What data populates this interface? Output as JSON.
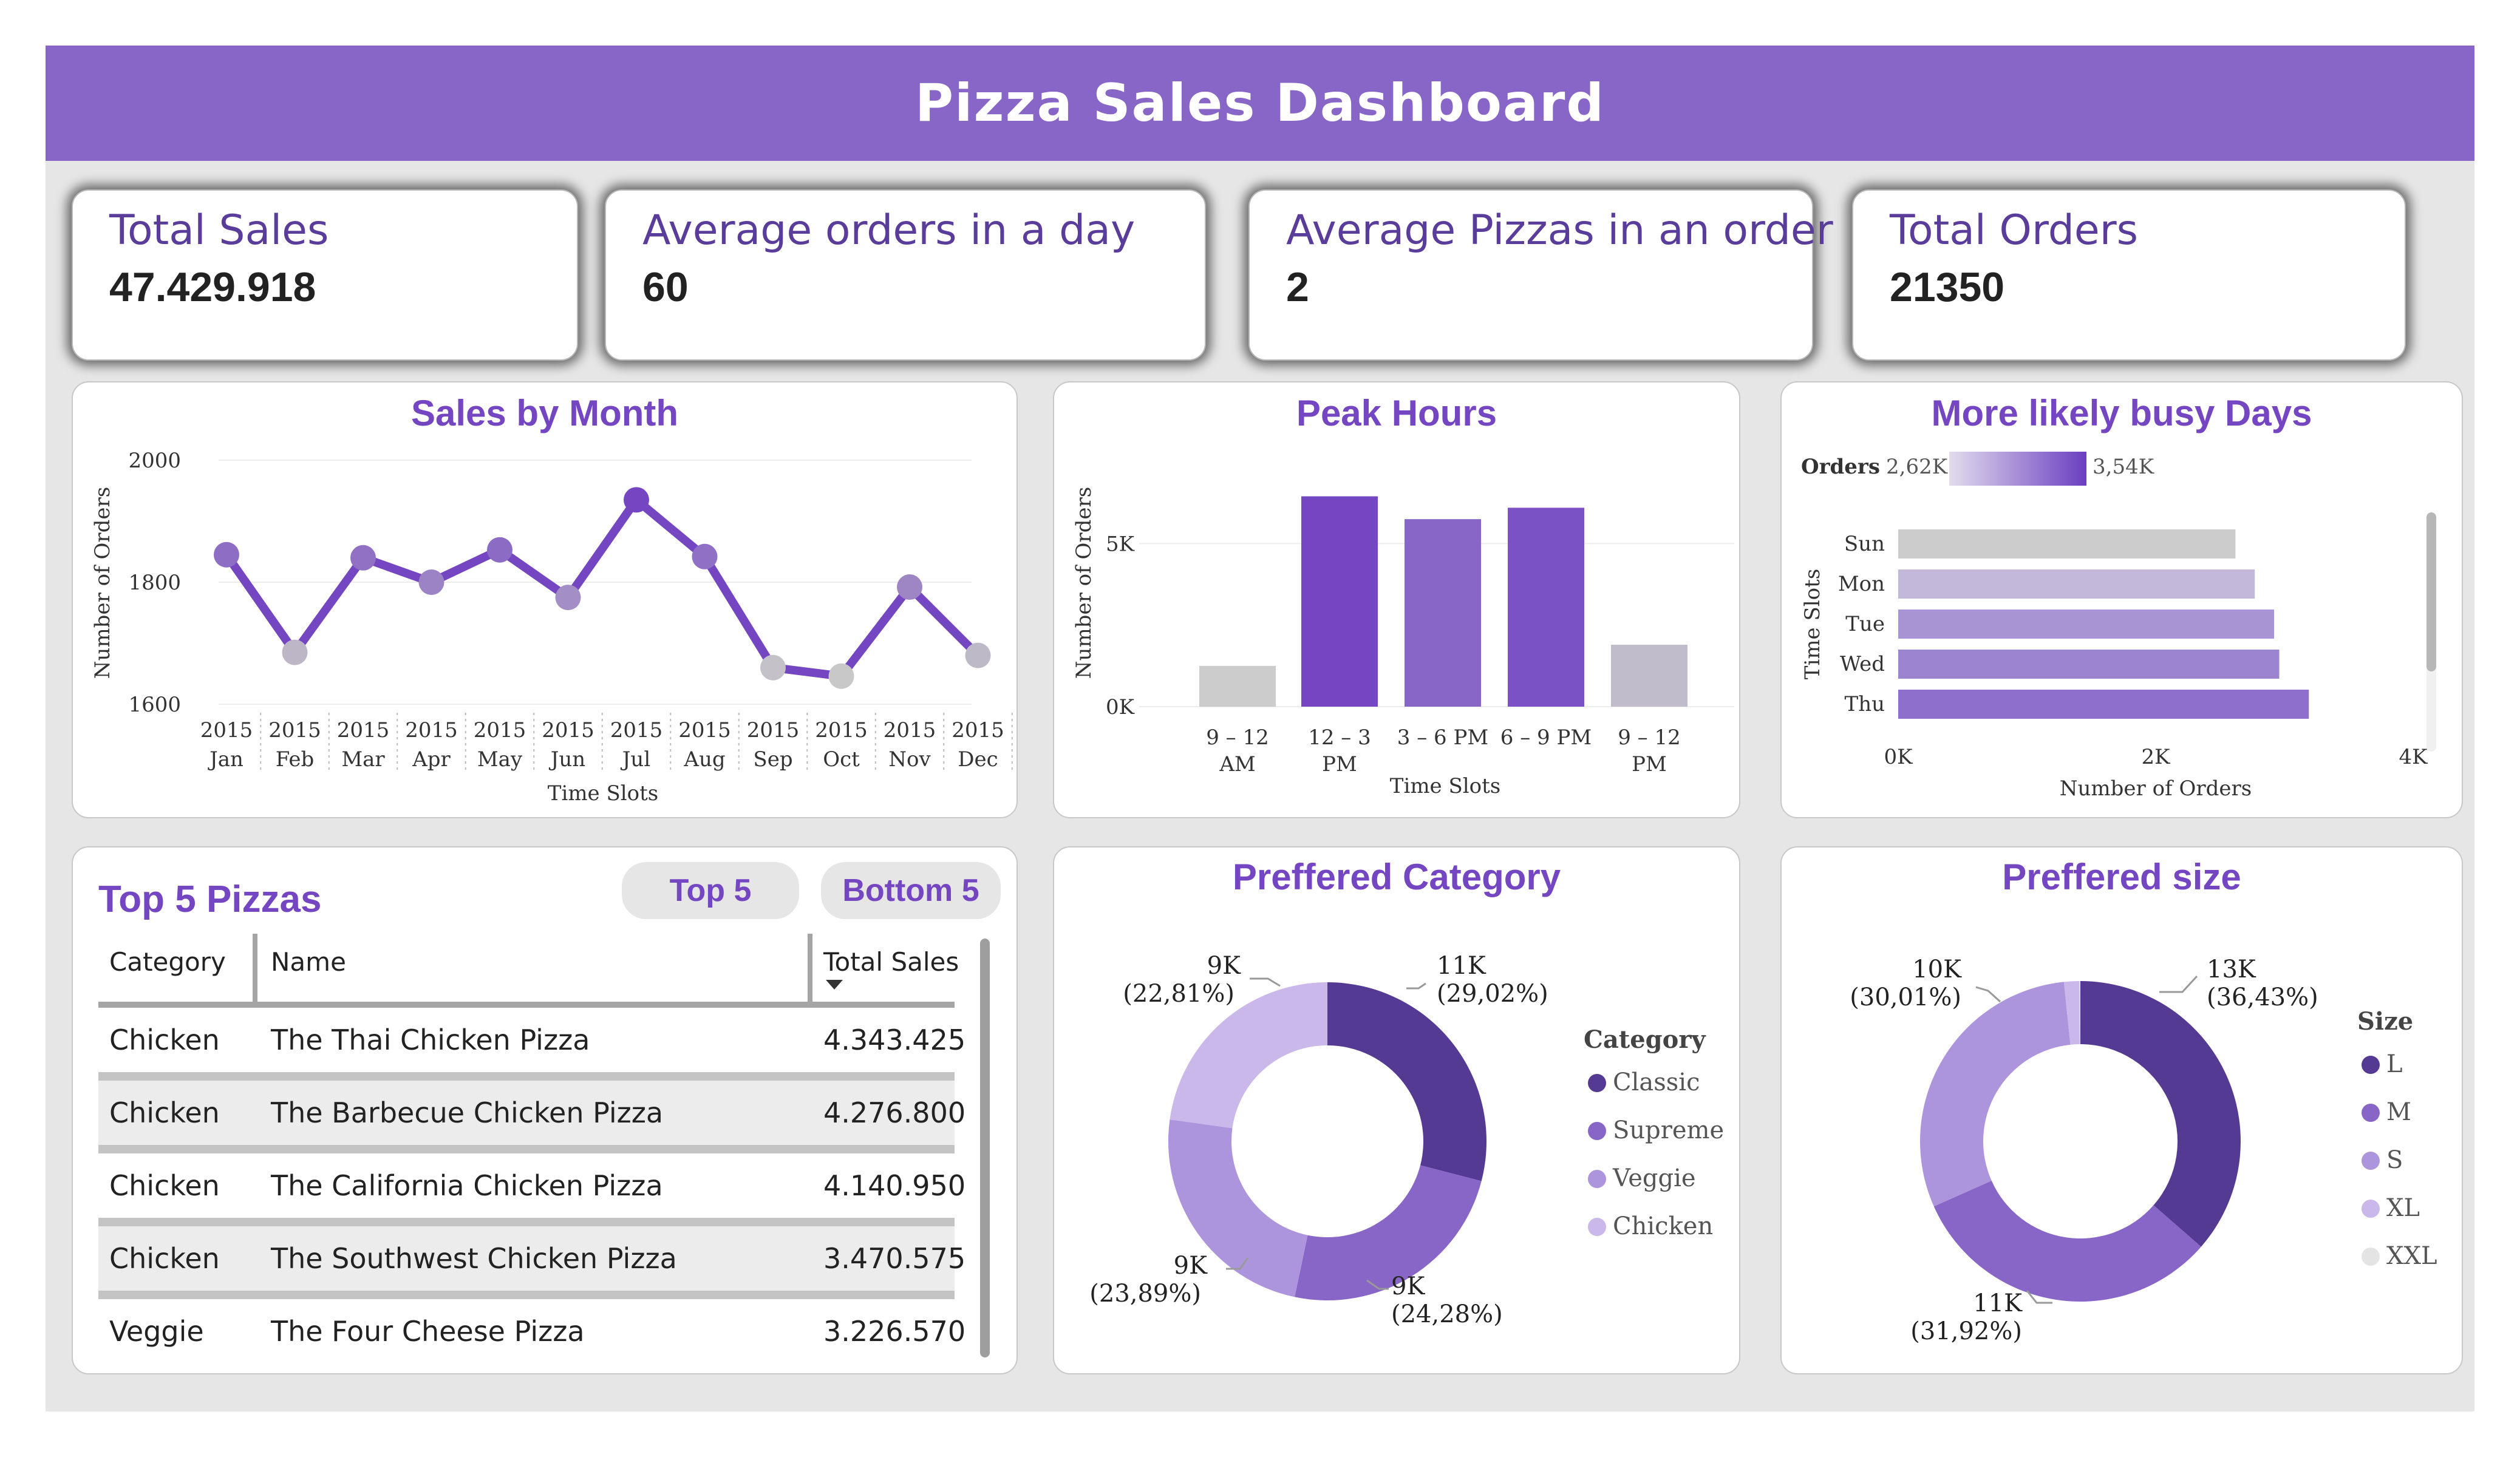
{
  "header": {
    "title": "Pizza Sales Dashboard"
  },
  "kpis": [
    {
      "label": "Total Sales",
      "value": "47.429.918"
    },
    {
      "label": "Average orders in a day",
      "value": "60"
    },
    {
      "label": "Average Pizzas in an order",
      "value": "2"
    },
    {
      "label": "Total Orders",
      "value": "21350"
    }
  ],
  "sales_by_month": {
    "title": "Sales by Month",
    "chart_data": {
      "type": "line",
      "title": "Sales by Month",
      "xlabel": "Time Slots",
      "ylabel": "Number of Orders",
      "ylim": [
        1600,
        2000
      ],
      "yticks": [
        "2000",
        "1800",
        "1600"
      ],
      "categories": [
        "Jan",
        "Feb",
        "Mar",
        "Apr",
        "May",
        "Jun",
        "Jul",
        "Aug",
        "Sep",
        "Oct",
        "Nov",
        "Dec"
      ],
      "year_label": "2015",
      "values": [
        1845,
        1685,
        1840,
        1800,
        1853,
        1775,
        1935,
        1842,
        1660,
        1646,
        1792,
        1680
      ],
      "line_color": "#7446c2"
    }
  },
  "peak_hours": {
    "title": "Peak Hours",
    "chart_data": {
      "type": "bar",
      "title": "Peak Hours",
      "xlabel": "Time Slots",
      "ylabel": "Number of Orders",
      "ylim": [
        0,
        7000
      ],
      "yticks": [
        "5K",
        "0K"
      ],
      "categories": [
        [
          "9 – 12",
          "AM"
        ],
        [
          "12 – 3",
          "PM"
        ],
        [
          "3 – 6 PM",
          ""
        ],
        [
          "6 – 9 PM",
          ""
        ],
        [
          "9 – 12",
          "PM"
        ]
      ],
      "values": [
        1250,
        6450,
        5750,
        6100,
        1900
      ],
      "colors": [
        "#cccccc",
        "#7446c2",
        "#8766c7",
        "#7a52c5",
        "#c1bccb"
      ]
    }
  },
  "busy_days": {
    "title": "More likely busy Days",
    "legend": {
      "label": "Orders",
      "min": "2,62K",
      "max": "3,54K"
    },
    "chart_data": {
      "type": "bar",
      "orientation": "horizontal",
      "title": "More likely busy Days",
      "xlabel": "Number of Orders",
      "ylabel": "Time Slots",
      "xlim": [
        0,
        4000
      ],
      "xticks": [
        "0K",
        "2K",
        "4K"
      ],
      "categories": [
        "Sun",
        "Mon",
        "Tue",
        "Wed",
        "Thu"
      ],
      "values": [
        2620,
        2770,
        2920,
        2960,
        3190
      ],
      "colors": [
        "#cccccc",
        "#c3b8da",
        "#a795d3",
        "#9c84d0",
        "#8f6fcc"
      ]
    }
  },
  "top_pizzas": {
    "title": "Top 5 Pizzas",
    "buttons": {
      "top": "Top 5",
      "bottom": "Bottom 5"
    },
    "columns": [
      "Category",
      "Name",
      "Total Sales"
    ],
    "rows": [
      [
        "Chicken",
        "The Thai Chicken Pizza",
        "4.343.425"
      ],
      [
        "Chicken",
        "The Barbecue Chicken Pizza",
        "4.276.800"
      ],
      [
        "Chicken",
        "The California Chicken Pizza",
        "4.140.950"
      ],
      [
        "Chicken",
        "The Southwest Chicken Pizza",
        "3.470.575"
      ],
      [
        "Veggie",
        "The Four Cheese Pizza",
        "3.226.570"
      ]
    ]
  },
  "preferred_category": {
    "title": "Preffered Category",
    "chart_data": {
      "type": "pie",
      "variant": "donut",
      "title": "Preffered Category",
      "legend_title": "Category",
      "labels": [
        "Classic",
        "Supreme",
        "Veggie",
        "Chicken"
      ],
      "values": [
        29.02,
        24.28,
        23.89,
        22.81
      ],
      "value_labels": [
        "11K",
        "9K",
        "9K",
        "9K"
      ],
      "pct_labels": [
        "(29,02%)",
        "(24,28%)",
        "(23,89%)",
        "(22,81%)"
      ],
      "colors": [
        "#553a93",
        "#8766c7",
        "#ad95dd",
        "#c9b8e9"
      ]
    }
  },
  "preferred_size": {
    "title": "Preffered size",
    "chart_data": {
      "type": "pie",
      "variant": "donut",
      "title": "Preffered size",
      "legend_title": "Size",
      "labels": [
        "L",
        "M",
        "S",
        "XL",
        "XXL"
      ],
      "values": [
        36.43,
        31.92,
        30.01,
        1.54,
        0.1
      ],
      "value_labels": [
        "13K",
        "11K",
        "10K",
        "",
        ""
      ],
      "pct_labels": [
        "(36,43%)",
        "(31,92%)",
        "(30,01%)",
        "",
        ""
      ],
      "colors": [
        "#553a93",
        "#8766c7",
        "#ad95dd",
        "#c9b8e9",
        "#e4e4e4"
      ]
    }
  }
}
